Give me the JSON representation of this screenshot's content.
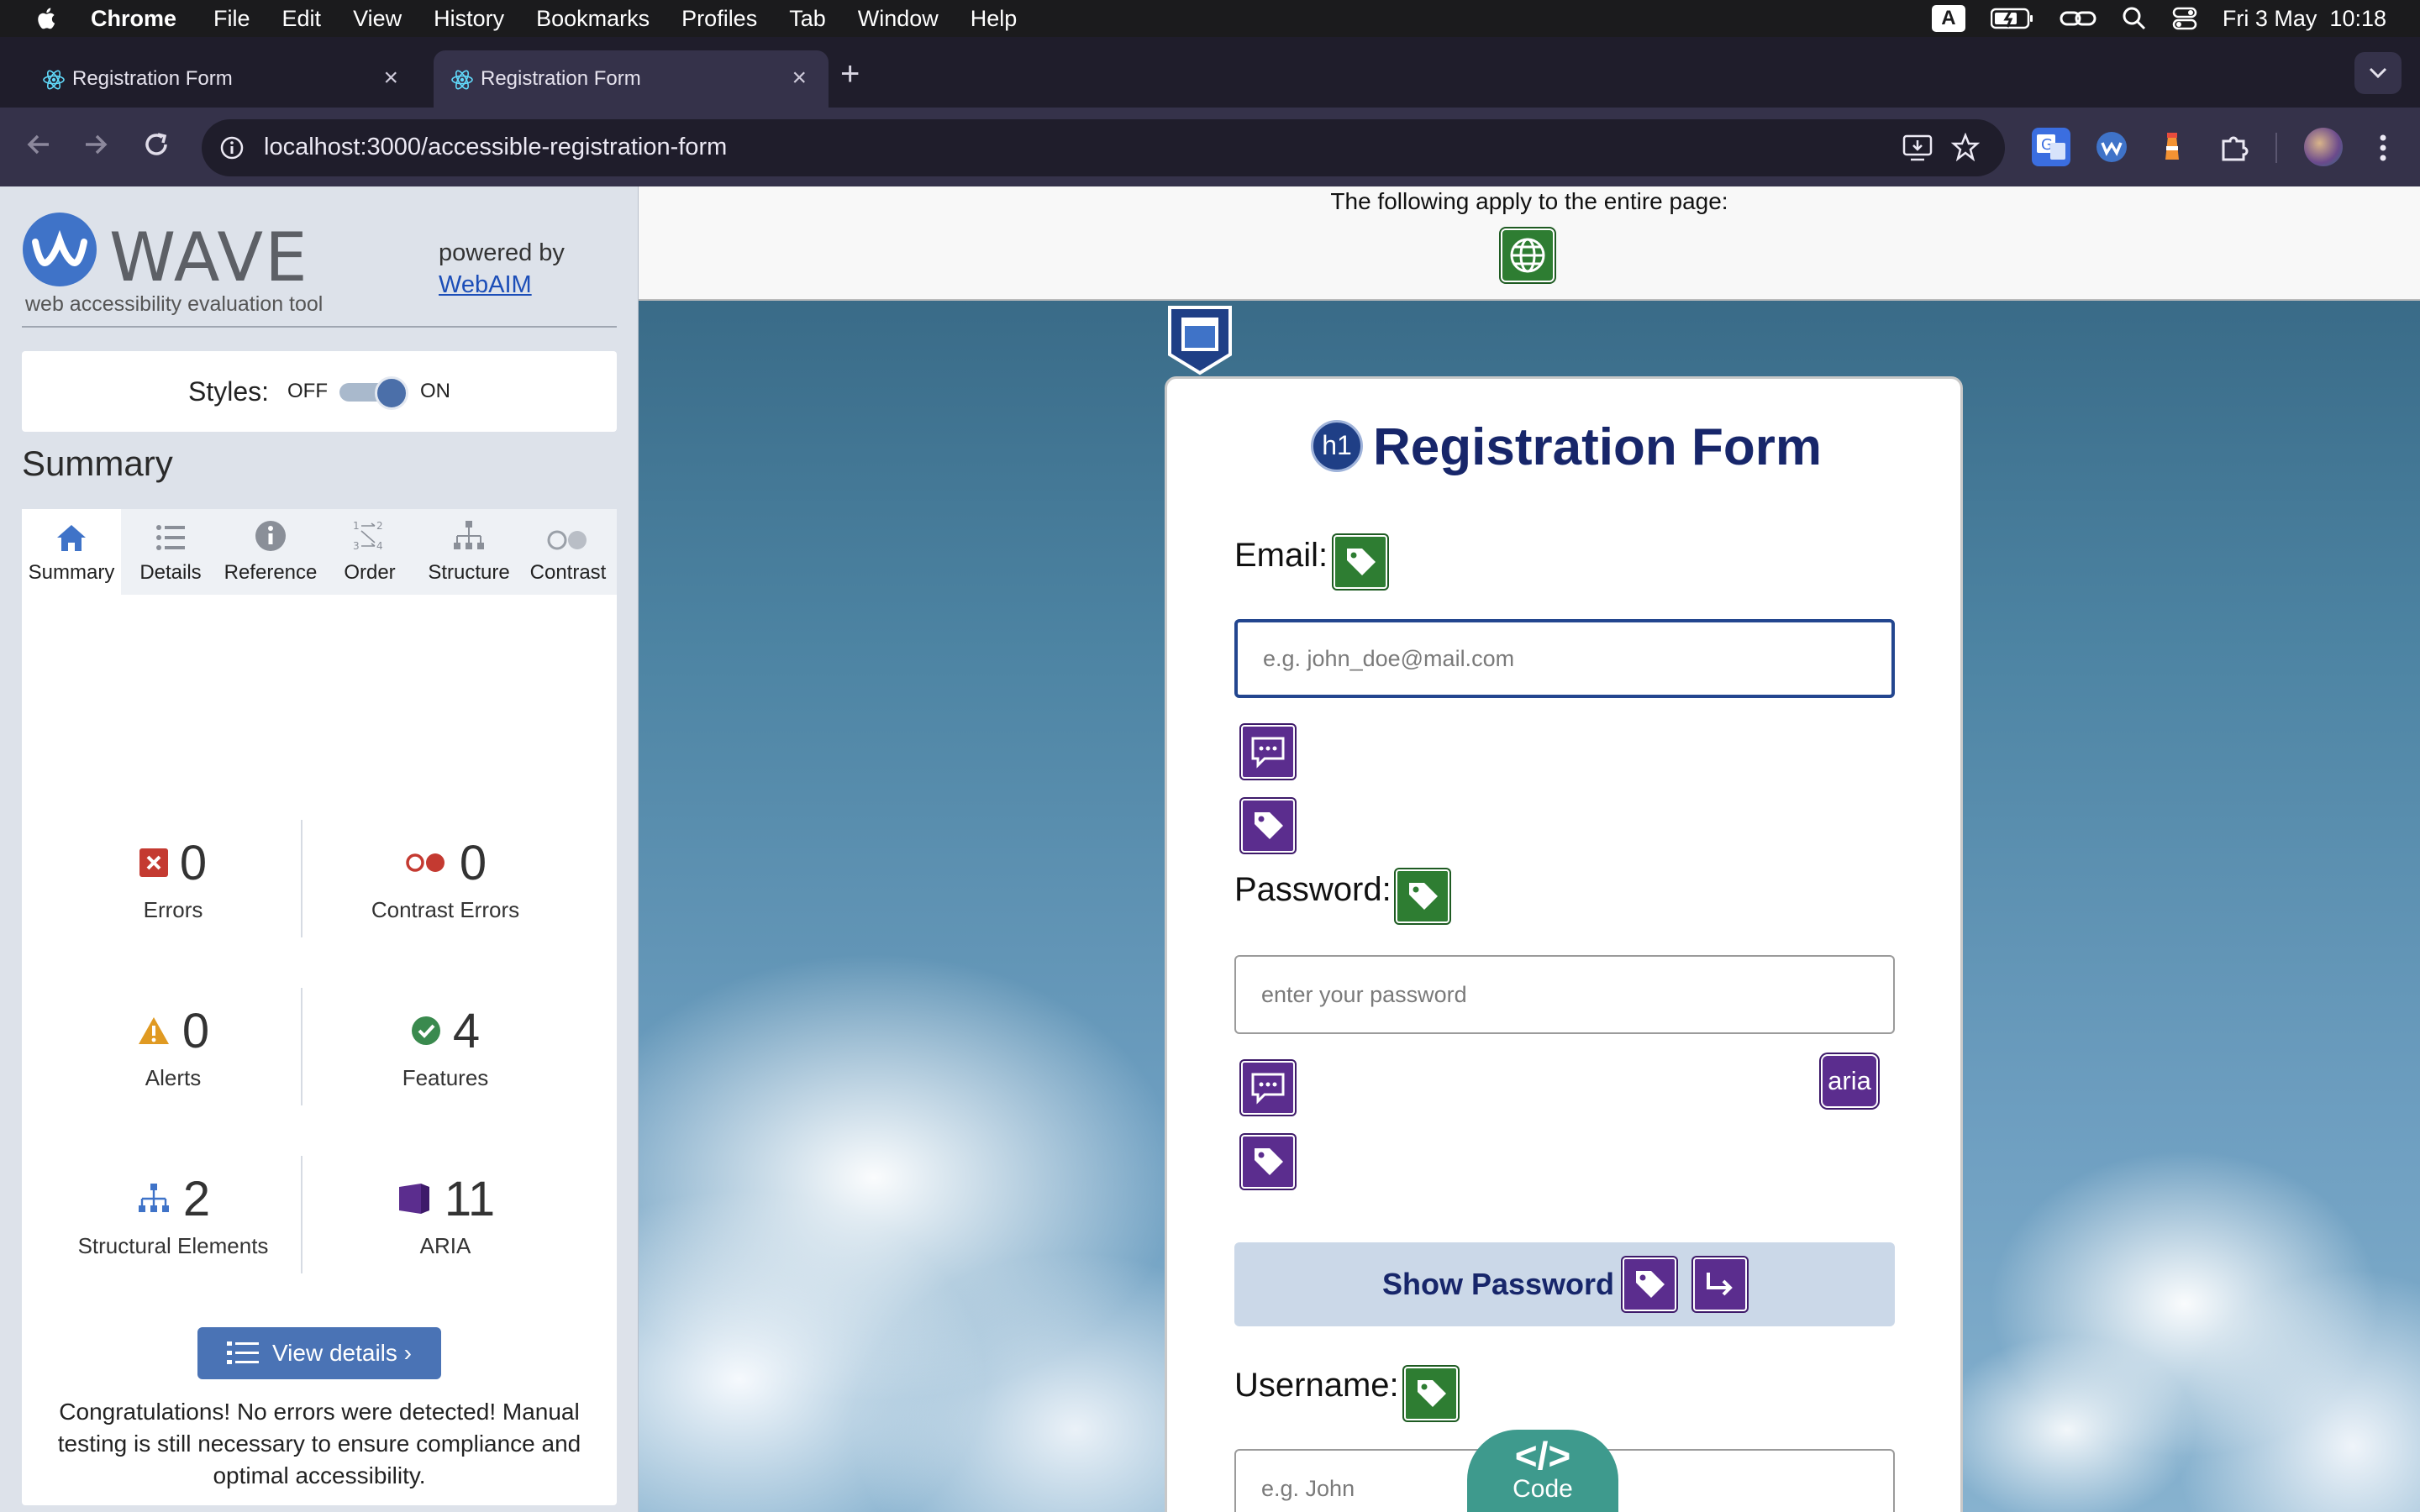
{
  "menubar": {
    "app": "Chrome",
    "items": [
      "File",
      "Edit",
      "View",
      "History",
      "Bookmarks",
      "Profiles",
      "Tab",
      "Window",
      "Help"
    ],
    "keyboard": "A",
    "datetime": "Fri 3 May  10:18"
  },
  "tabs": [
    {
      "title": "Registration Form"
    },
    {
      "title": "Registration Form"
    }
  ],
  "omnibox": {
    "url": "localhost:3000/accessible-registration-form"
  },
  "wave": {
    "title": "WAVE",
    "subtitle": "web accessibility evaluation tool",
    "powered_by": "powered by",
    "webaim": "WebAIM",
    "styles_label": "Styles:",
    "styles_off": "OFF",
    "styles_on": "ON",
    "summary_heading": "Summary",
    "tabs": [
      "Summary",
      "Details",
      "Reference",
      "Order",
      "Structure",
      "Contrast"
    ],
    "stats": {
      "errors": {
        "count": "0",
        "label": "Errors"
      },
      "contrast": {
        "count": "0",
        "label": "Contrast Errors"
      },
      "alerts": {
        "count": "0",
        "label": "Alerts"
      },
      "features": {
        "count": "4",
        "label": "Features"
      },
      "structural": {
        "count": "2",
        "label": "Structural Elements"
      },
      "aria": {
        "count": "11",
        "label": "ARIA"
      }
    },
    "view_details": "View details ›",
    "congrats": "Congratulations! No errors were detected! Manual testing is still necessary to ensure compliance and optimal accessibility."
  },
  "page": {
    "banner_text": "The following apply to the entire page:",
    "form": {
      "title": "Registration Form",
      "h1_badge": "h1",
      "email_label": "Email:",
      "email_placeholder": "e.g. john_doe@mail.com",
      "password_label": "Password:",
      "password_placeholder": "enter your password",
      "aria_badge": "aria",
      "show_password": "Show Password",
      "username_label": "Username:",
      "username_placeholder": "e.g. John"
    },
    "code_button": {
      "glyph": "</>",
      "label": "Code"
    }
  },
  "colors": {
    "wave_blue": "#4a73b5",
    "wave_purple": "#5b2d8e",
    "wave_green": "#2e7d32",
    "form_title": "#17266a",
    "code_teal": "#3e9a8d"
  },
  "icons": [
    "apple-icon",
    "battery-icon",
    "wifi-icon",
    "search-icon",
    "control-center-icon",
    "react-icon",
    "globe-icon",
    "tag-icon",
    "comment-icon",
    "region-icon",
    "arrow-icon"
  ]
}
